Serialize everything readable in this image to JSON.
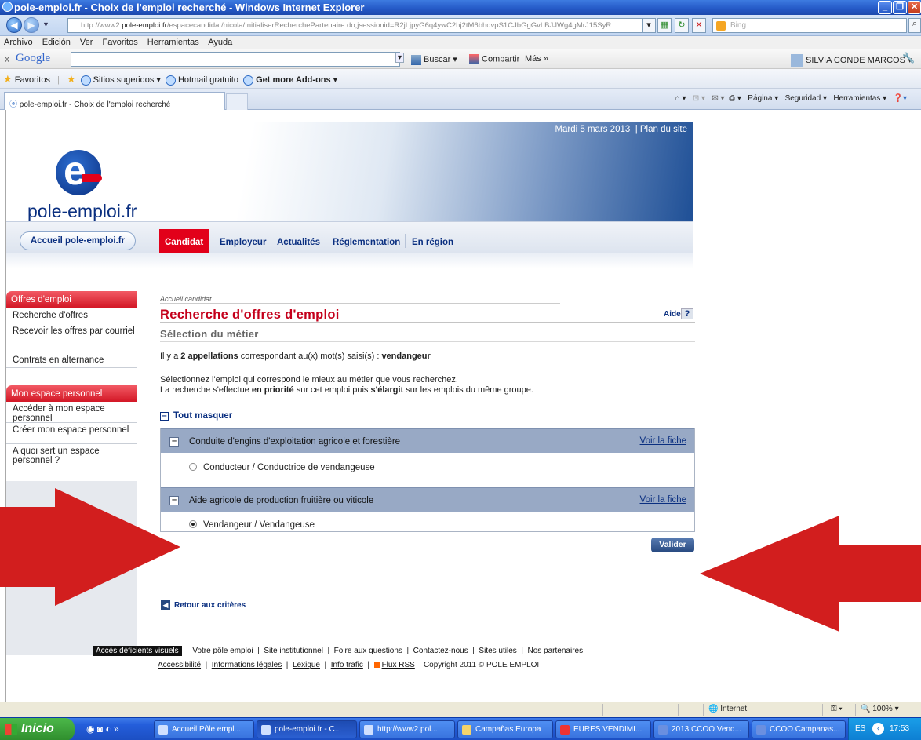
{
  "browser": {
    "title": "pole-emploi.fr - Choix de l'emploi recherché - Windows Internet Explorer",
    "url_prefix": "http://www2.",
    "url_domain": "pole-emploi.fr",
    "url_rest": "/espacecandidat/nicola/InitialiserRecherchePartenaire.do;jsessionid=R2jLjpyG6q4ywC2hj2tM6bhdvpS1CJbGgGvLBJJWg4gMrJ15SyR",
    "search_placeholder": "Bing",
    "menu": [
      "Archivo",
      "Edición",
      "Ver",
      "Favoritos",
      "Herramientas",
      "Ayuda"
    ],
    "google": {
      "logo": "Google",
      "buscar": "Buscar",
      "compartir": "Compartir",
      "mas": "Más »",
      "user": "SILVIA CONDE MARCOS"
    },
    "favorites": {
      "label": "Favoritos",
      "sitios": "Sitios sugeridos",
      "hotmail": "Hotmail gratuito",
      "addons": "Get more Add-ons"
    },
    "tab_title": "pole-emploi.fr - Choix de l'emploi recherché",
    "commands": {
      "pagina": "Página",
      "seguridad": "Seguridad",
      "herramientas": "Herramientas"
    },
    "status": {
      "zone": "Internet",
      "zoom": "100%"
    }
  },
  "site": {
    "logo_text": "pole-emploi.fr",
    "date": "Mardi 5 mars 2013",
    "plan": "Plan du site",
    "home_button": "Accueil pole-emploi.fr",
    "nav": [
      "Candidat",
      "Employeur",
      "Actualités",
      "Réglementation",
      "En région"
    ]
  },
  "sidebar": {
    "section1": "Offres d'emploi",
    "items1": [
      "Recherche d'offres",
      "Recevoir les offres par courriel",
      "Contrats en alternance"
    ],
    "section2": "Mon espace personnel",
    "items2": [
      "Accéder à mon espace personnel",
      "Créer mon espace personnel",
      "A quoi sert un espace personnel ?"
    ]
  },
  "main": {
    "breadcrumb": "Accueil candidat",
    "title": "Recherche d'offres d'emploi",
    "aide": "Aide",
    "subtitle": "Sélection du métier",
    "info_pre": "Il y a ",
    "info_count": "2 appellations",
    "info_mid": " correspondant au(x) mot(s) saisi(s) : ",
    "info_word": "vendangeur",
    "instr1": "Sélectionnez l'emploi qui correspond le mieux au métier que vous recherchez.",
    "instr2_a": "La recherche s'effectue ",
    "instr2_b": "en priorité",
    "instr2_c": " sur cet emploi puis ",
    "instr2_d": "s'élargit",
    "instr2_e": " sur les emplois du même groupe.",
    "toggle_all": "Tout masquer",
    "groups": [
      {
        "label": "Conduite d'engins d'exploitation agricole et forestière",
        "link": "Voir la fiche",
        "option": "Conducteur / Conductrice de vendangeuse",
        "selected": false
      },
      {
        "label": "Aide agricole de production fruitière ou viticole",
        "link": "Voir la fiche",
        "option": "Vendangeur / Vendangeuse",
        "selected": true
      }
    ],
    "submit": "Valider",
    "back": "Retour aux critères"
  },
  "footer": {
    "accessibility": "Accès déficients visuels",
    "links1": [
      "Votre pôle emploi",
      "Site institutionnel",
      "Foire aux questions",
      "Contactez-nous",
      "Sites utiles",
      "Nos partenaires"
    ],
    "links2": [
      "Accessibilité",
      "Informations légales",
      "Lexique",
      "Info trafic",
      "Flux RSS"
    ],
    "copyright": "Copyright 2011 © POLE EMPLOI"
  },
  "taskbar": {
    "start": "Inicio",
    "tasks": [
      "Accueil Pôle empl...",
      "pole-emploi.fr - C...",
      "http://www2.pol...",
      "Campañas Europa",
      "EURES VENDIMI...",
      "2013 CCOO Vend...",
      "CCOO Campanas..."
    ],
    "lang": "ES",
    "time": "17:53"
  },
  "colors": {
    "arrow": "#d21e1e",
    "accent": "#e2001a",
    "brand_blue": "#0a2f80"
  }
}
